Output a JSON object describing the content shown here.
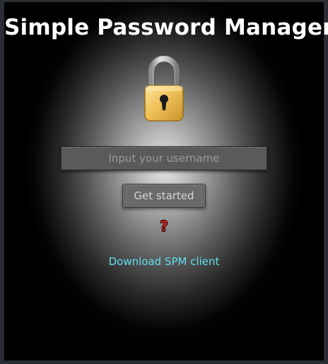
{
  "app": {
    "title": "Simple Password Manager"
  },
  "icons": {
    "lock": "padlock-icon",
    "help": "question-mark-icon"
  },
  "form": {
    "username_placeholder": "Input your username",
    "username_value": "",
    "submit_label": "Get started",
    "help_symbol": "?"
  },
  "links": {
    "download_label": "Download SPM client"
  },
  "colors": {
    "background": "#000000",
    "title": "#ffffff",
    "link": "#5ee0f0",
    "help": "#d21c1c",
    "lock_body": "#f0c060",
    "lock_shackle": "#b8b8b8"
  }
}
